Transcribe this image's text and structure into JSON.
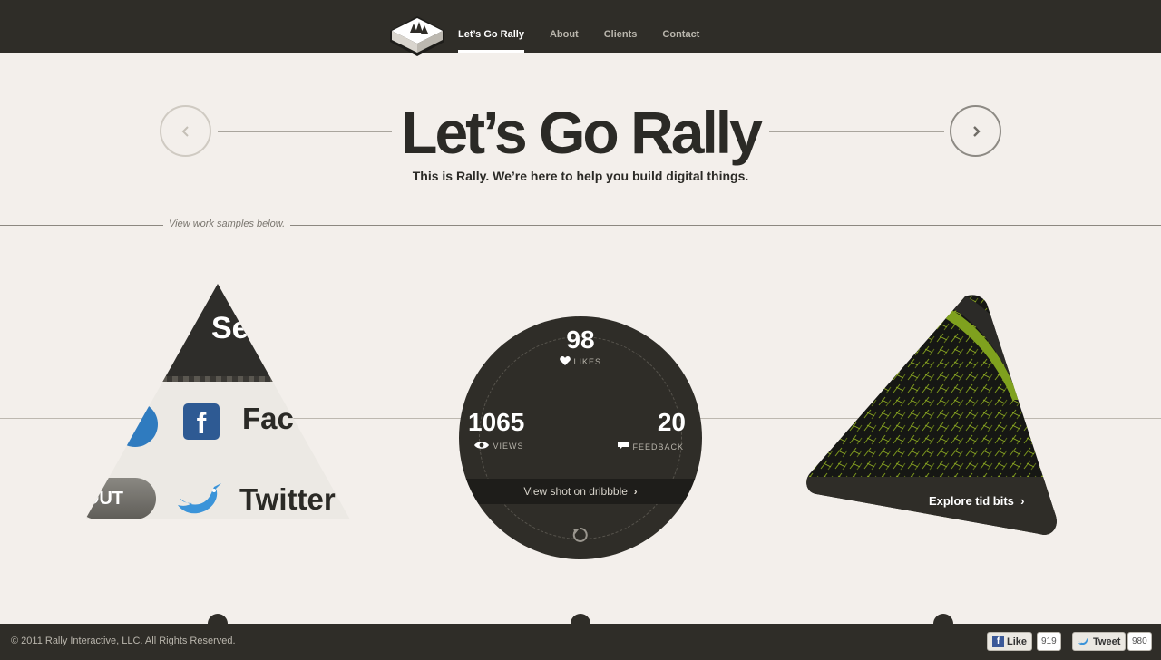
{
  "nav": {
    "items": [
      {
        "label": "Let’s Go Rally",
        "active": true
      },
      {
        "label": "About"
      },
      {
        "label": "Clients"
      },
      {
        "label": "Contact"
      }
    ]
  },
  "hero": {
    "title": "Let’s Go Rally",
    "subtitle": "This is Rally. We’re here to help you build digital things.",
    "divider_text": "View work samples below."
  },
  "left_sample": {
    "top_text": "Se",
    "facebook_text": "Fac",
    "out_text": "OUT",
    "twitter_text": "Twitter"
  },
  "stats": {
    "likes": "98",
    "likes_label": "LIKES",
    "views": "1065",
    "views_label": "VIEWS",
    "feedback": "20",
    "feedback_label": "FEEDBACK",
    "dribbble_link": "View shot on dribbble"
  },
  "right_sample": {
    "explore_label": "Explore tid bits",
    "accent_color": "#7fa11e"
  },
  "footer": {
    "copyright": "© 2011 Rally Interactive, LLC. All Rights Reserved.",
    "like_label": "Like",
    "like_count": "919",
    "tweet_label": "Tweet",
    "tweet_count": "980"
  },
  "icons": [
    "logo-icon",
    "chevron-left-icon",
    "chevron-right-icon",
    "facebook-icon",
    "twitter-bird-icon",
    "heart-icon",
    "eye-icon",
    "speech-bubble-icon",
    "refresh-icon"
  ]
}
